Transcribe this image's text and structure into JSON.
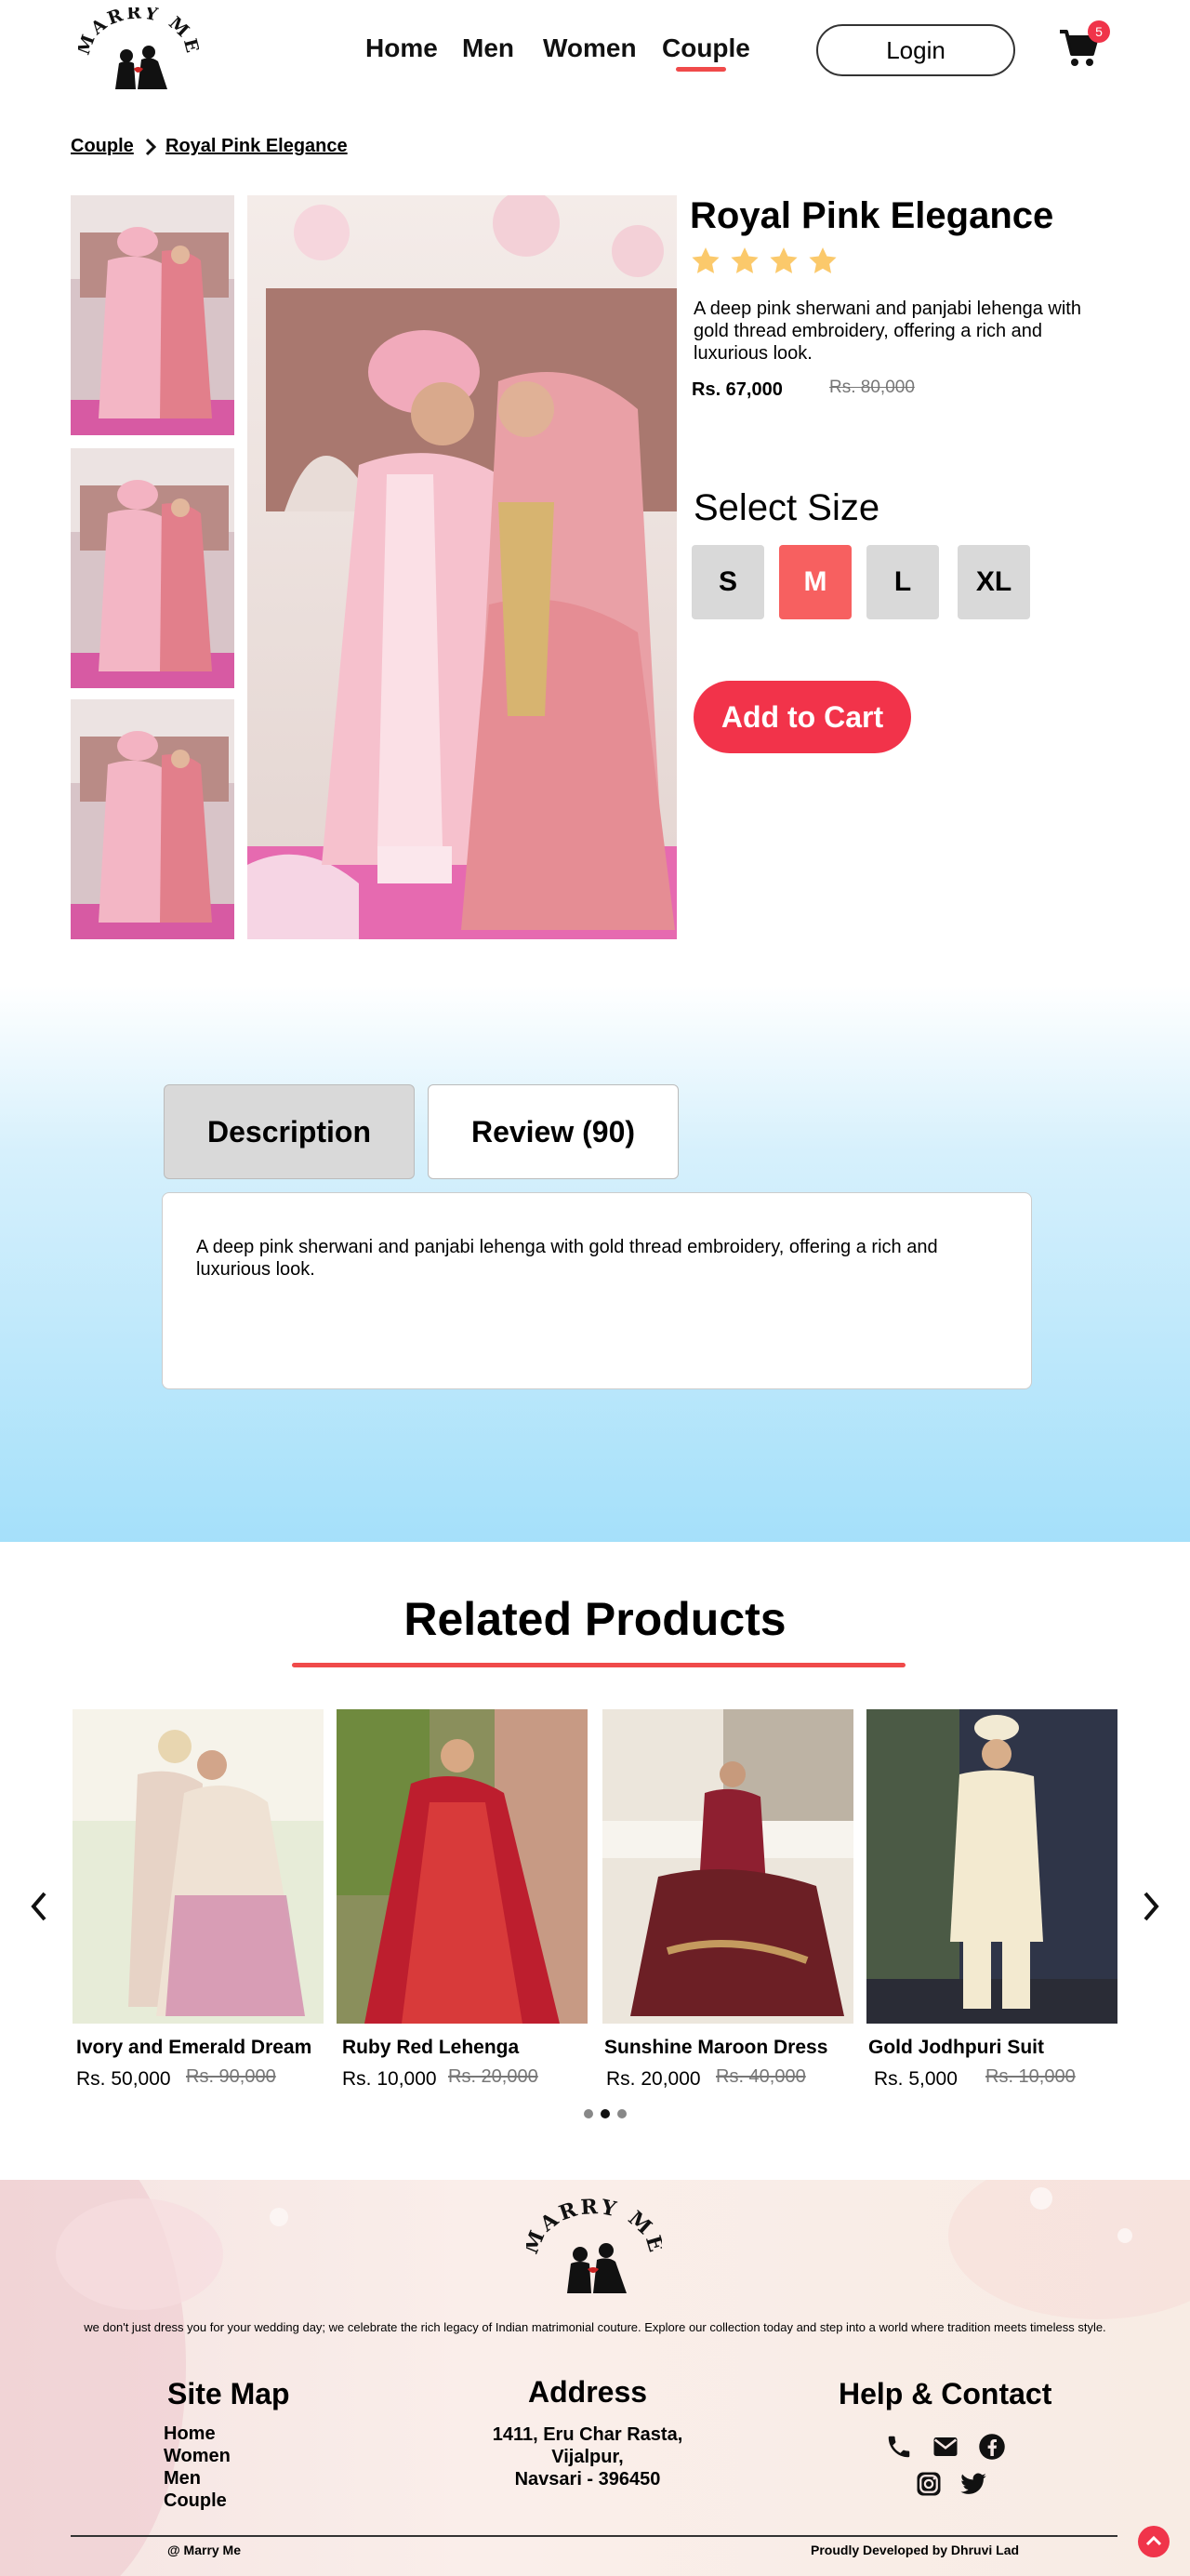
{
  "brand": {
    "logo_text": "MARRY ME"
  },
  "nav": {
    "items": [
      {
        "label": "Home"
      },
      {
        "label": "Men"
      },
      {
        "label": "Women"
      },
      {
        "label": "Couple"
      }
    ],
    "active": "Couple",
    "login_label": "Login",
    "cart_count": "5"
  },
  "breadcrumb": {
    "parent": "Couple",
    "current": "Royal Pink Elegance"
  },
  "product": {
    "title": "Royal Pink Elegance",
    "rating": 4,
    "description": "A deep pink  sherwani and panjabi lehenga with gold thread embroidery, offering a rich and luxurious look.",
    "price": "Rs. 67,000",
    "old_price": "Rs. 80,000",
    "size_label": "Select Size",
    "sizes": [
      "S",
      "M",
      "L",
      "XL"
    ],
    "selected_size": "M",
    "add_to_cart": "Add to Cart"
  },
  "tabs": {
    "description_label": "Description",
    "review_label": "Review (90)",
    "active": "Description",
    "description_text": "A deep pink  sherwani and panjabi lehenga with gold thread embroidery, offering a rich and luxurious look."
  },
  "related": {
    "title": "Related Products",
    "items": [
      {
        "name": "Ivory and Emerald Dream",
        "price": "Rs. 50,000",
        "old_price": "Rs. 90,000"
      },
      {
        "name": "Ruby Red Lehenga",
        "price": "Rs. 10,000",
        "old_price": "Rs. 20,000"
      },
      {
        "name": "Sunshine Maroon Dress",
        "price": "Rs. 20,000",
        "old_price": "Rs. 40,000"
      },
      {
        "name": "Gold Jodhpuri Suit",
        "price": "Rs. 5,000",
        "old_price": "Rs. 10,000"
      }
    ],
    "page_active": 2,
    "page_count": 3
  },
  "footer": {
    "tagline": "we don't just dress you for your wedding day; we celebrate the rich legacy of Indian matrimonial couture. Explore our collection today and step into a world where tradition meets timeless style.",
    "sitemap_title": "Site Map",
    "sitemap": [
      "Home",
      "Women",
      "Men",
      "Couple"
    ],
    "address_title": "Address",
    "address_lines": [
      "1411, Eru Char Rasta,",
      "Vijalpur,",
      "Navsari - 396450"
    ],
    "help_title": "Help & Contact",
    "copyright": "@ Marry Me",
    "credit": "Proudly Developed by Dhruvi Lad"
  },
  "colors": {
    "accent": "#f2334a",
    "selected_size": "#f76060",
    "star": "#fbc96b"
  }
}
